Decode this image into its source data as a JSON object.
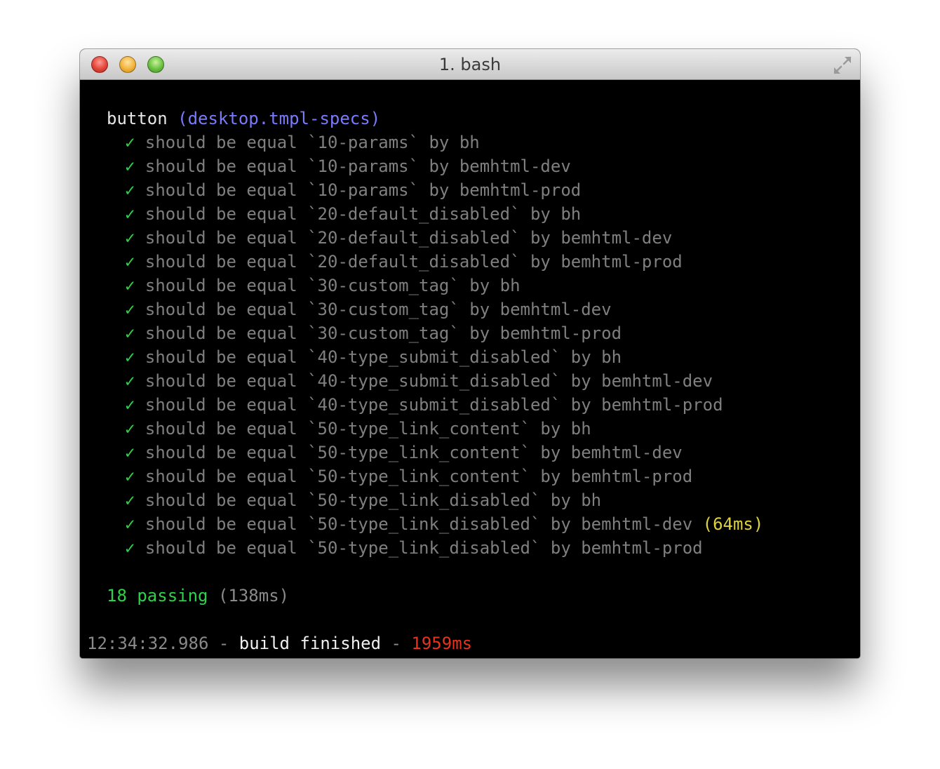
{
  "window": {
    "title": "1. bash"
  },
  "suite": {
    "name": "button",
    "file": "(desktop.tmpl-specs)"
  },
  "check_mark": "✓",
  "tests": [
    {
      "text": "should be equal `10-params` by bh"
    },
    {
      "text": "should be equal `10-params` by bemhtml-dev"
    },
    {
      "text": "should be equal `10-params` by bemhtml-prod"
    },
    {
      "text": "should be equal `20-default_disabled` by bh"
    },
    {
      "text": "should be equal `20-default_disabled` by bemhtml-dev"
    },
    {
      "text": "should be equal `20-default_disabled` by bemhtml-prod"
    },
    {
      "text": "should be equal `30-custom_tag` by bh"
    },
    {
      "text": "should be equal `30-custom_tag` by bemhtml-dev"
    },
    {
      "text": "should be equal `30-custom_tag` by bemhtml-prod"
    },
    {
      "text": "should be equal `40-type_submit_disabled` by bh"
    },
    {
      "text": "should be equal `40-type_submit_disabled` by bemhtml-dev"
    },
    {
      "text": "should be equal `40-type_submit_disabled` by bemhtml-prod"
    },
    {
      "text": "should be equal `50-type_link_content` by bh"
    },
    {
      "text": "should be equal `50-type_link_content` by bemhtml-dev"
    },
    {
      "text": "should be equal `50-type_link_content` by bemhtml-prod"
    },
    {
      "text": "should be equal `50-type_link_disabled` by bh"
    },
    {
      "text": "should be equal `50-type_link_disabled` by bemhtml-dev",
      "duration": "(64ms)"
    },
    {
      "text": "should be equal `50-type_link_disabled` by bemhtml-prod"
    }
  ],
  "summary": {
    "passing": "18 passing",
    "duration": "(138ms)"
  },
  "build": {
    "timestamp": "12:34:32.986",
    "separator": " - ",
    "message": "build finished",
    "separator2": " - ",
    "time": "1959ms"
  },
  "colors": {
    "check": "#2fd14b",
    "suite_file": "#7a7aff",
    "slow": "#e0d23b",
    "build_time": "#e8321e",
    "terminal_bg": "#000000"
  }
}
